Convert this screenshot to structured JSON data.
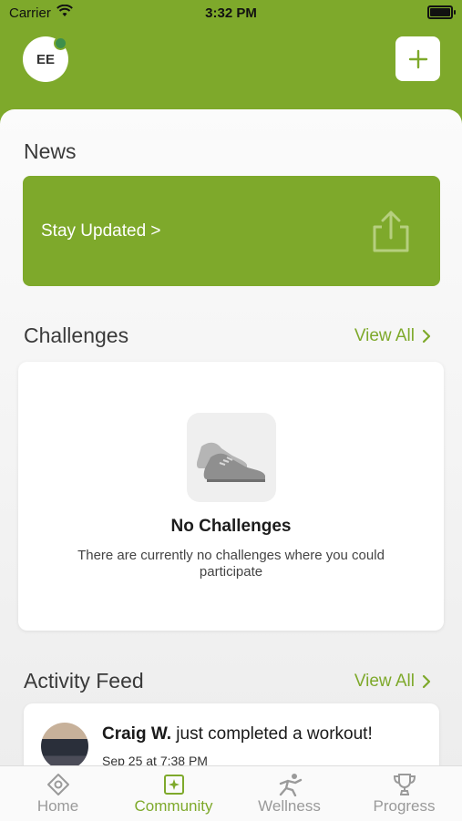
{
  "status_bar": {
    "carrier": "Carrier",
    "time": "3:32 PM"
  },
  "header": {
    "avatar_initials": "EE"
  },
  "news": {
    "title": "News",
    "card_text": "Stay Updated >"
  },
  "challenges": {
    "title": "Challenges",
    "view_all": "View All",
    "empty_title": "No Challenges",
    "empty_desc": "There are currently no challenges where you could participate"
  },
  "activity_feed": {
    "title": "Activity Feed",
    "view_all": "View All",
    "items": [
      {
        "user": "Craig W.",
        "action": "just completed a workout!",
        "date": "Sep 25 at 7:38 PM"
      }
    ]
  },
  "tabs": [
    {
      "label": "Home",
      "icon": "home-icon"
    },
    {
      "label": "Community",
      "icon": "community-icon"
    },
    {
      "label": "Wellness",
      "icon": "wellness-icon"
    },
    {
      "label": "Progress",
      "icon": "progress-icon"
    }
  ],
  "colors": {
    "accent": "#7ea92b"
  }
}
